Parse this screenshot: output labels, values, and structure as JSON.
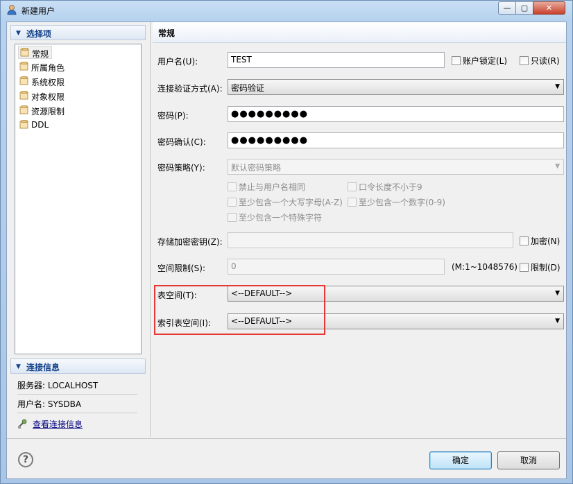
{
  "window": {
    "title": "新建用户",
    "min_label": "—",
    "max_label": "▢",
    "close_label": "✕"
  },
  "left": {
    "section_title": "选择项",
    "tree": [
      "常规",
      "所属角色",
      "系统权限",
      "对象权限",
      "资源限制",
      "DDL"
    ],
    "selected": "常规",
    "conn_title": "连接信息",
    "server_line": "服务器: LOCALHOST",
    "user_line": "用户名: SYSDBA",
    "view_link": "查看连接信息"
  },
  "right": {
    "header": "常规",
    "username_label": "用户名(U):",
    "username_value": "TEST",
    "account_lock_label": "账户锁定(L)",
    "readonly_label": "只读(R)",
    "auth_label": "连接验证方式(A):",
    "auth_value": "密码验证",
    "password_label": "密码(P):",
    "password_value": "●●●●●●●●●",
    "confirm_label": "密码确认(C):",
    "confirm_value": "●●●●●●●●●",
    "policy_label": "密码策略(Y):",
    "policy_value": "默认密码策略",
    "policy_options": [
      "禁止与用户名相同",
      "口令长度不小于9",
      "至少包含一个大写字母(A-Z)",
      "至少包含一个数字(0-9)",
      "至少包含一个特殊字符"
    ],
    "encrypt_key_label": "存储加密密钥(Z):",
    "encrypt_label": "加密(N)",
    "space_limit_label": "空间限制(S):",
    "space_limit_value": "0",
    "space_range": "(M:1~1048576)",
    "limit_label": "限制(D)",
    "tablespace_label": "表空间(T):",
    "tablespace_value": "<--DEFAULT-->",
    "index_tablespace_label": "索引表空间(I):",
    "index_tablespace_value": "<--DEFAULT-->"
  },
  "footer": {
    "ok": "确定",
    "cancel": "取消",
    "help": "?"
  },
  "colors": {
    "highlight_box": "#e53935",
    "link": "#000080",
    "section_title": "#15428b"
  }
}
